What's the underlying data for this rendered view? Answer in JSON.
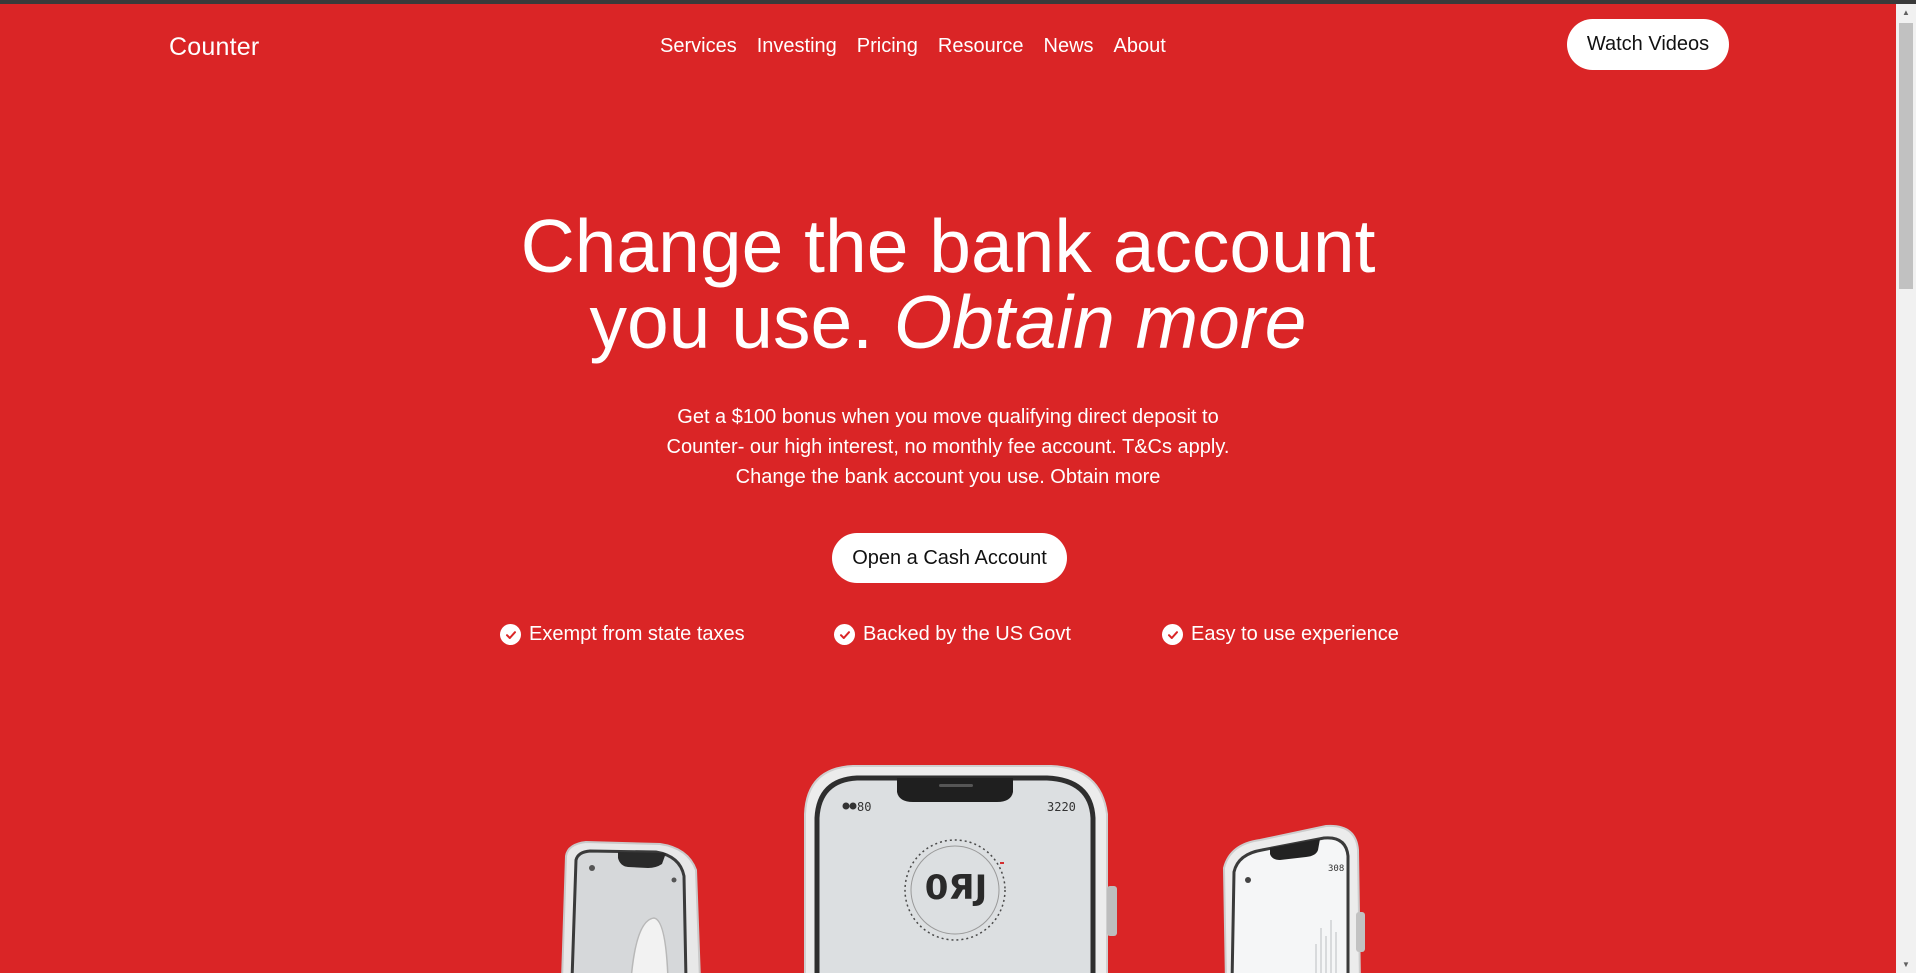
{
  "brand": "Counter",
  "nav": {
    "items": [
      "Services",
      "Investing",
      "Pricing",
      "Resource",
      "News",
      "About"
    ],
    "cta_label": "Watch Videos"
  },
  "hero": {
    "headline_line1": "Change the bank account",
    "headline_line2_plain": "you use. ",
    "headline_line2_italic": "Obtain more",
    "subtext_line1": "Get a $100 bonus when you move qualifying direct deposit to",
    "subtext_line2": "Counter- our high interest, no monthly fee account. T&Cs apply.",
    "subtext_line3": "Change the bank account you use. Obtain more",
    "cta_label": "Open a Cash Account"
  },
  "features": [
    {
      "label": "Exempt from state taxes",
      "icon": "check-circle-icon"
    },
    {
      "label": "Backed by the US Govt",
      "icon": "check-circle-icon"
    },
    {
      "label": "Easy to use experience",
      "icon": "check-circle-icon"
    }
  ],
  "phones": {
    "center": {
      "status_left": "80",
      "status_right": "3220",
      "display": "0ЯJ"
    },
    "right": {
      "status_right": "308"
    }
  },
  "colors": {
    "brand_red": "#da2526",
    "white": "#ffffff",
    "dark_text": "#111111"
  }
}
